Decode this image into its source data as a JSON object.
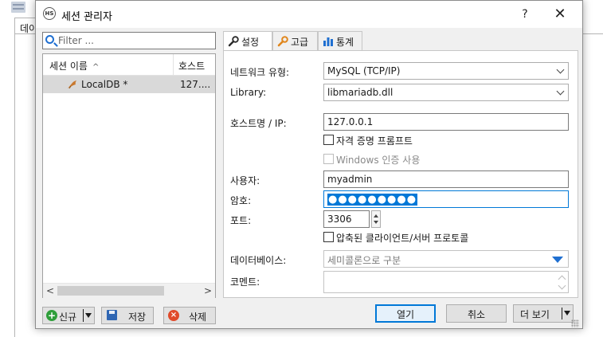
{
  "background": {
    "tab_label": "데이"
  },
  "dialog": {
    "logo": "HS",
    "title": "세션 관리자",
    "help": "?",
    "close": "✕"
  },
  "left": {
    "filter_placeholder": "Filter ...",
    "columns": {
      "name": "세션 이름",
      "sort": "^",
      "host": "호스트"
    },
    "rows": [
      {
        "name": "LocalDB *",
        "host": "127...."
      }
    ],
    "scroll_left": "<",
    "scroll_right": ">",
    "buttons": {
      "new": "신규",
      "new_icon": "+",
      "save": "저장",
      "delete": "삭제",
      "delete_icon": "×"
    }
  },
  "tabs": [
    {
      "label": "설정",
      "icon": "wrench-icon",
      "active": true
    },
    {
      "label": "고급",
      "icon": "wrench-orange-icon",
      "active": false
    },
    {
      "label": "통계",
      "icon": "bar-chart-icon",
      "active": false
    }
  ],
  "settings": {
    "network_type_label": "네트워크 유형:",
    "network_type_value": "MySQL (TCP/IP)",
    "library_label": "Library:",
    "library_value": "libmariadb.dll",
    "host_label": "호스트명 / IP:",
    "host_value": "127.0.0.1",
    "prompt_credentials": "자격 증명 프롬프트",
    "windows_auth": "Windows 인증 사용",
    "user_label": "사용자:",
    "user_value": "myadmin",
    "password_label": "암호:",
    "password_value": "●●●●●●●●●",
    "port_label": "포트:",
    "port_value": "3306",
    "compressed": "압축된 클라이언트/서버 프로토콜",
    "database_label": "데이터베이스:",
    "database_placeholder": "세미콜론으로 구분",
    "comment_label": "코멘트:"
  },
  "footer": {
    "open": "열기",
    "cancel": "취소",
    "more": "더 보기"
  },
  "colors": {
    "accent": "#0078d7",
    "new": "#2e9e3a",
    "delete": "#e04a2a",
    "save": "#2f66b3"
  }
}
